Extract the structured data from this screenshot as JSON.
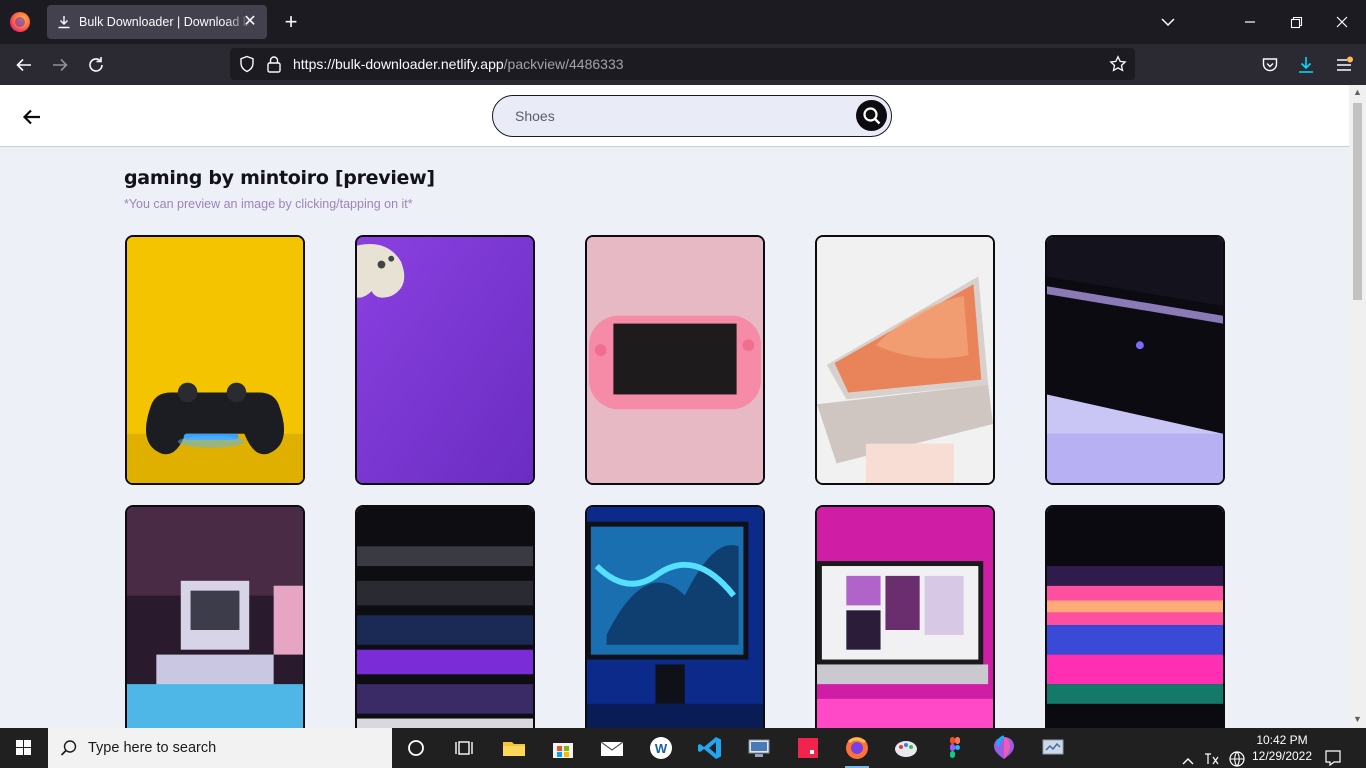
{
  "browser": {
    "tab_title": "Bulk Downloader | Download bulk images",
    "url_host": "https://bulk-downloader.netlify.app",
    "url_path": "/packview/4486333"
  },
  "header": {
    "search_placeholder": "Shoes"
  },
  "pack": {
    "title": "gaming by mintoiro [preview]",
    "hint": "*You can preview an image by clicking/tapping on it*"
  },
  "images": [
    {
      "subject": "gamepad-on-yellow"
    },
    {
      "subject": "white-controller-on-purple"
    },
    {
      "subject": "pink-handheld-console"
    },
    {
      "subject": "laptop-on-desk"
    },
    {
      "subject": "console-closeup-purple-light"
    },
    {
      "subject": "retro-computers-pink-blue"
    },
    {
      "subject": "backlit-keyboard"
    },
    {
      "subject": "monitor-blue-setup"
    },
    {
      "subject": "imac-pink-light"
    },
    {
      "subject": "laptop-neon-lights"
    }
  ],
  "taskbar": {
    "search_text": "Type here to search",
    "time": "10:42 PM",
    "date": "12/29/2022"
  }
}
